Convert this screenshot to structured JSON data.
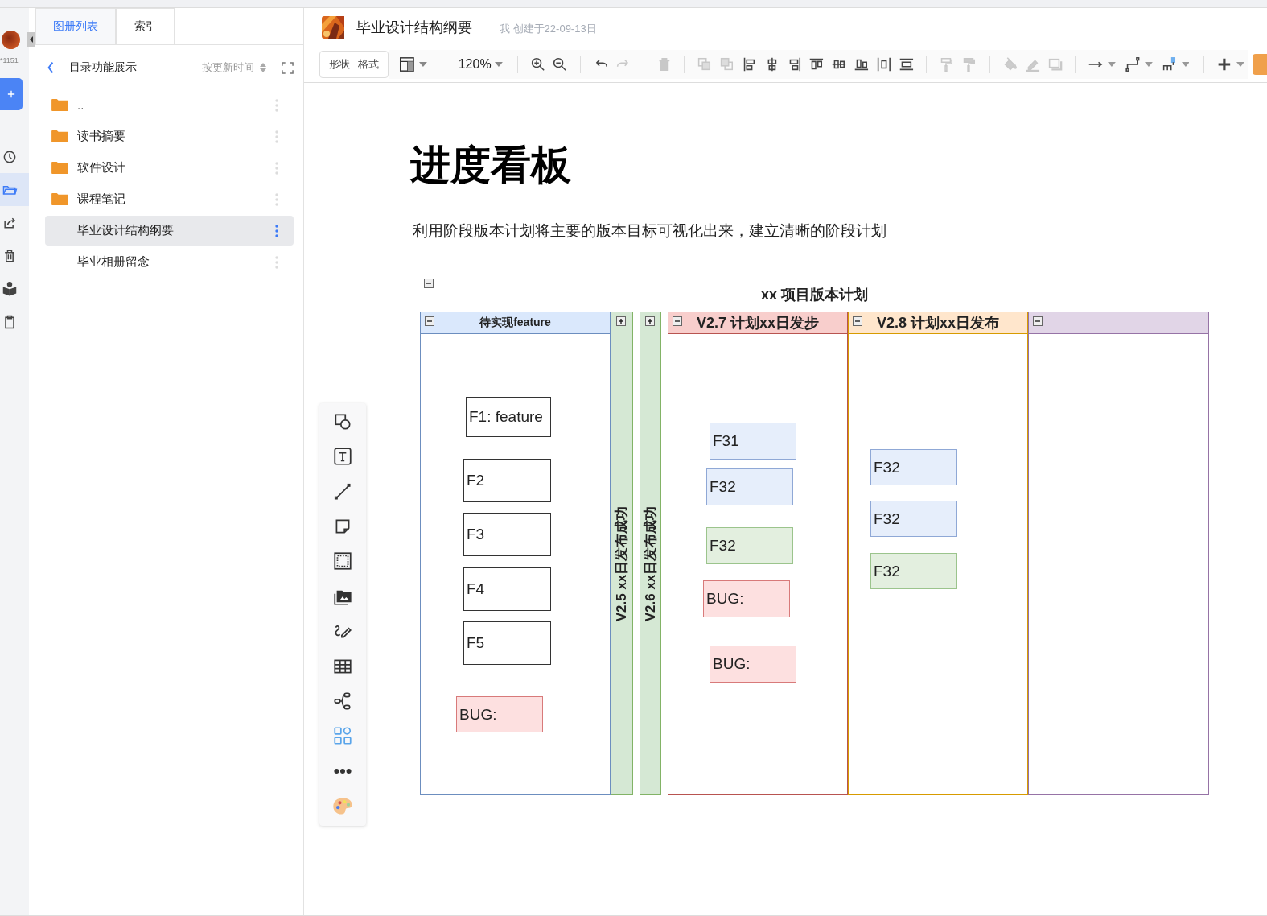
{
  "rail": {
    "user_id": "*1151",
    "items": [
      {
        "selected": false
      },
      {
        "selected": true
      },
      {
        "selected": false
      },
      {
        "selected": false
      },
      {
        "selected": false
      },
      {
        "selected": false
      }
    ]
  },
  "sidebar": {
    "tabs": [
      {
        "label": "图册列表",
        "selected": true
      },
      {
        "label": "索引",
        "selected": false
      }
    ],
    "folder_title": "目录功能展示",
    "sort": "按更新时间",
    "items": [
      {
        "label": "..",
        "kind": "folder",
        "selected": false
      },
      {
        "label": "读书摘要",
        "kind": "folder",
        "selected": false
      },
      {
        "label": "软件设计",
        "kind": "folder",
        "selected": false
      },
      {
        "label": "课程笔记",
        "kind": "folder",
        "selected": false
      },
      {
        "label": "毕业设计结构纲要",
        "kind": "document",
        "selected": true
      },
      {
        "label": "毕业相册留念",
        "kind": "document",
        "selected": false
      }
    ]
  },
  "document": {
    "title": "毕业设计结构纲要",
    "meta": "我 创建于22-09-13日"
  },
  "toolbar": {
    "tabs": [
      {
        "label": "形状"
      },
      {
        "label": "格式"
      }
    ],
    "zoom": "120%"
  },
  "canvas": {
    "heading": "进度看板",
    "description": "利用阶段版本计划将主要的版本目标可视化出来，建立清晰的阶段计划",
    "pool": {
      "title": "xx 项目版本计划",
      "lanes": [
        {
          "title": "待实现feature",
          "color": "#dae8fc",
          "collapsed": false,
          "cards": [
            {
              "text": "F1: feature",
              "color": "#ffffff"
            },
            {
              "text": "F2",
              "color": "#ffffff"
            },
            {
              "text": "F3",
              "color": "#ffffff"
            },
            {
              "text": "F4",
              "color": "#ffffff"
            },
            {
              "text": "F5",
              "color": "#ffffff"
            },
            {
              "text": "BUG:",
              "color": "#fde0e0"
            }
          ]
        },
        {
          "title": "V2.5 xx日发布成功",
          "color": "#d5e8d4",
          "collapsed": true
        },
        {
          "title": "V2.6 xx日发布成功",
          "color": "#d5e8d4",
          "collapsed": true
        },
        {
          "title": "V2.7 计划xx日发步",
          "color": "#f8cecc",
          "collapsed": false,
          "cards": [
            {
              "text": "F31",
              "color": "#e6eefb"
            },
            {
              "text": "F32",
              "color": "#e6eefb"
            },
            {
              "text": "F32",
              "color": "#e3efdf"
            },
            {
              "text": "BUG:",
              "color": "#fde0e0"
            },
            {
              "text": "BUG:",
              "color": "#fde0e0"
            }
          ]
        },
        {
          "title": "V2.8 计划xx日发布",
          "color": "#ffe6cc",
          "collapsed": false,
          "cards": [
            {
              "text": "F32",
              "color": "#e6eefb"
            },
            {
              "text": "F32",
              "color": "#e6eefb"
            },
            {
              "text": "F32",
              "color": "#e3efdf"
            }
          ]
        },
        {
          "color": "#e1d5e7",
          "collapsed": false
        }
      ]
    }
  }
}
